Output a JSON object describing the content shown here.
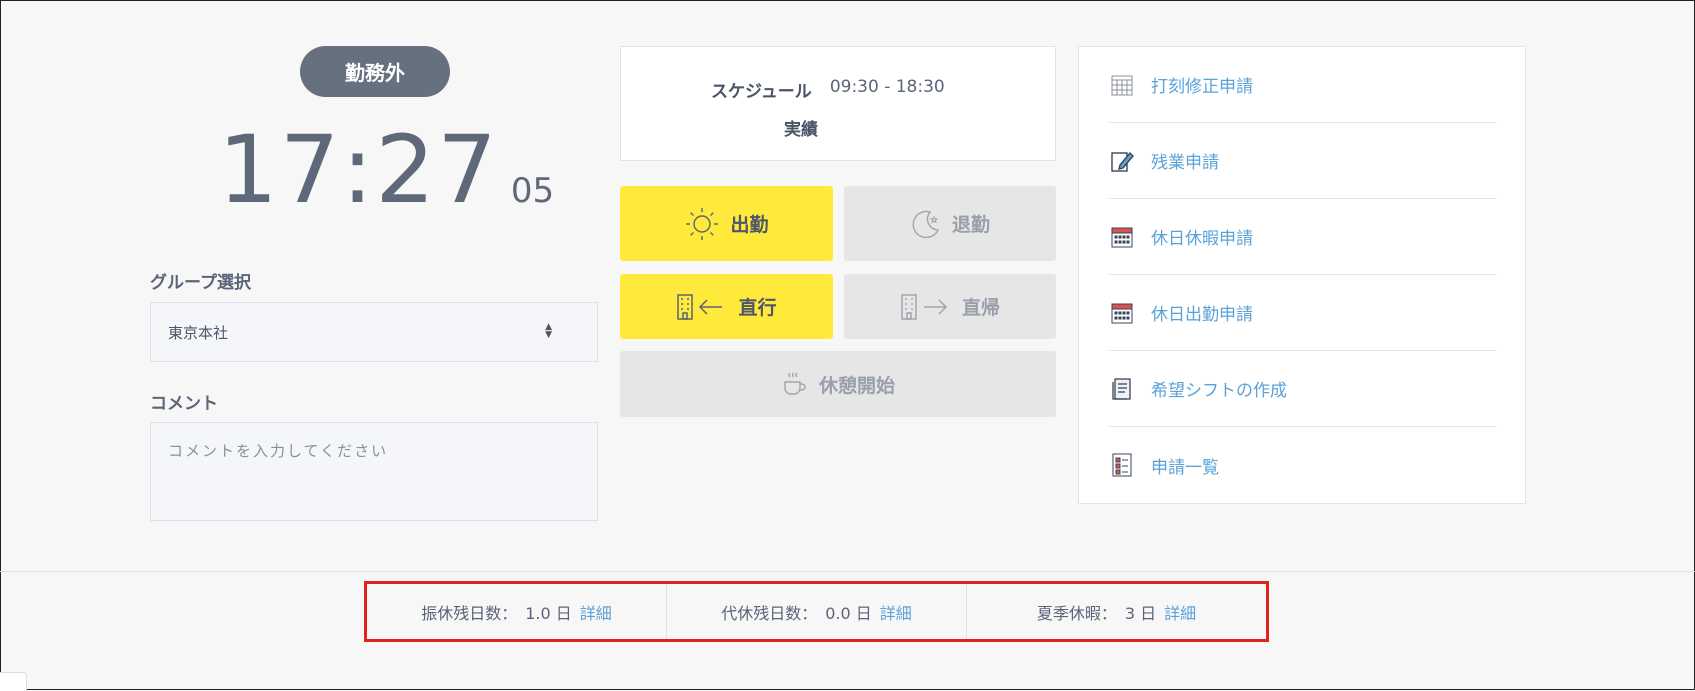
{
  "status": {
    "label": "勤務外"
  },
  "clock": {
    "time": "17:27",
    "seconds": "05"
  },
  "group": {
    "label": "グループ選択",
    "selected": "東京本社"
  },
  "comment": {
    "label": "コメント",
    "placeholder": "コメントを入力してください"
  },
  "schedule": {
    "label": "スケジュール",
    "value": "09:30 - 18:30",
    "actual_label": "実績"
  },
  "buttons": {
    "clock_in": "出勤",
    "clock_out": "退勤",
    "direct_go": "直行",
    "direct_return": "直帰",
    "break_start": "休憩開始"
  },
  "menu": {
    "items": [
      {
        "label": "打刻修正申請",
        "icon": "calendar-grid-icon"
      },
      {
        "label": "残業申請",
        "icon": "pencil-note-icon"
      },
      {
        "label": "休日休暇申請",
        "icon": "calendar-red-icon"
      },
      {
        "label": "休日出勤申請",
        "icon": "calendar-red-icon"
      },
      {
        "label": "希望シフトの作成",
        "icon": "document-icon"
      },
      {
        "label": "申請一覧",
        "icon": "checklist-icon"
      }
    ]
  },
  "summary": {
    "items": [
      {
        "label": "振休残日数：",
        "value": "1.0 日",
        "link": "詳細"
      },
      {
        "label": "代休残日数：",
        "value": "0.0 日",
        "link": "詳細"
      },
      {
        "label": "夏季休暇：",
        "value": "3 日",
        "link": "詳細"
      }
    ]
  },
  "colors": {
    "accent_yellow": "#ffe93b",
    "link_blue": "#5aa2d8",
    "pill_gray": "#66707f",
    "highlight_red": "#e2231a"
  }
}
